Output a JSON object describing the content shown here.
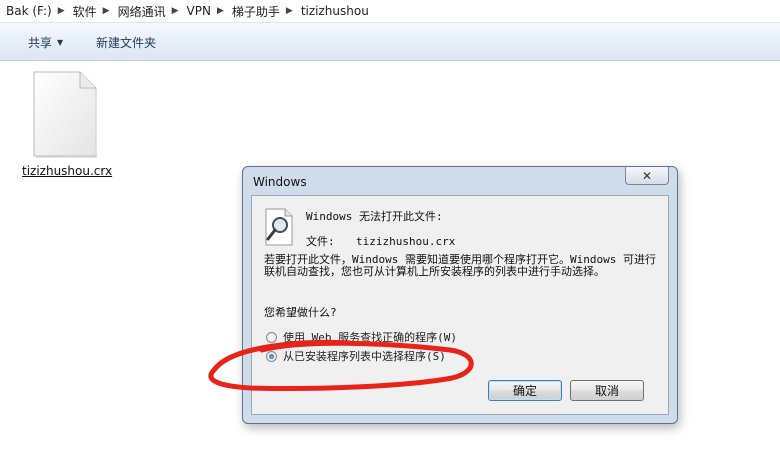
{
  "breadcrumb": [
    {
      "label": "Bak (F:)"
    },
    {
      "label": "软件"
    },
    {
      "label": "网络通讯"
    },
    {
      "label": "VPN"
    },
    {
      "label": "梯子助手"
    },
    {
      "label": "tizizhushou"
    }
  ],
  "toolbar": {
    "share_label": "共享",
    "new_folder_label": "新建文件夹"
  },
  "file": {
    "name": "tizizhushou.crx"
  },
  "dialog": {
    "title": "Windows",
    "heading": "Windows 无法打开此文件:",
    "file_label": "文件:",
    "file_name": "tizizhushou.crx",
    "description": "若要打开此文件，Windows 需要知道要使用哪个程序打开它。Windows 可进行联机自动查找，您也可从计算机上所安装程序的列表中进行手动选择。",
    "question": "您希望做什么?",
    "options": [
      {
        "label": "使用 Web 服务查找正确的程序(W)",
        "checked": false
      },
      {
        "label": "从已安装程序列表中选择程序(S)",
        "checked": true
      }
    ],
    "ok_label": "确定",
    "cancel_label": "取消"
  },
  "colors": {
    "annotation": "#e8231a",
    "dialog_frame": "#cfdcea",
    "toolbar_text": "#1e395b"
  }
}
